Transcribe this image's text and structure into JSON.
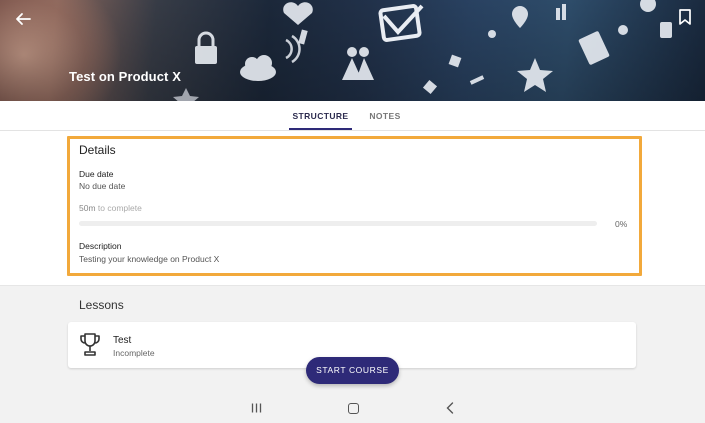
{
  "header": {
    "title": "Test on Product X",
    "back_icon": "arrow-left-icon",
    "bookmark_icon": "bookmark-icon"
  },
  "tabs": [
    {
      "label": "STRUCTURE",
      "active": true
    },
    {
      "label": "NOTES",
      "active": false
    }
  ],
  "details": {
    "heading": "Details",
    "due_date_label": "Due date",
    "due_date_value": "No due date",
    "duration": "50m",
    "duration_suffix": "to complete",
    "progress_fraction": 0.0,
    "progress_text": "0%",
    "description_label": "Description",
    "description_value": "Testing your knowledge on Product X"
  },
  "lessons": {
    "heading": "Lessons",
    "items": [
      {
        "title": "Test",
        "status": "Incomplete",
        "icon": "trophy-icon"
      }
    ]
  },
  "actions": {
    "start_label": "START COURSE"
  },
  "colors": {
    "accent": "#2e2a78",
    "highlight": "#f2a93b"
  },
  "system_nav": {
    "recent_icon": "recent-apps-icon",
    "home_icon": "home-icon",
    "back_icon": "nav-back-icon"
  }
}
